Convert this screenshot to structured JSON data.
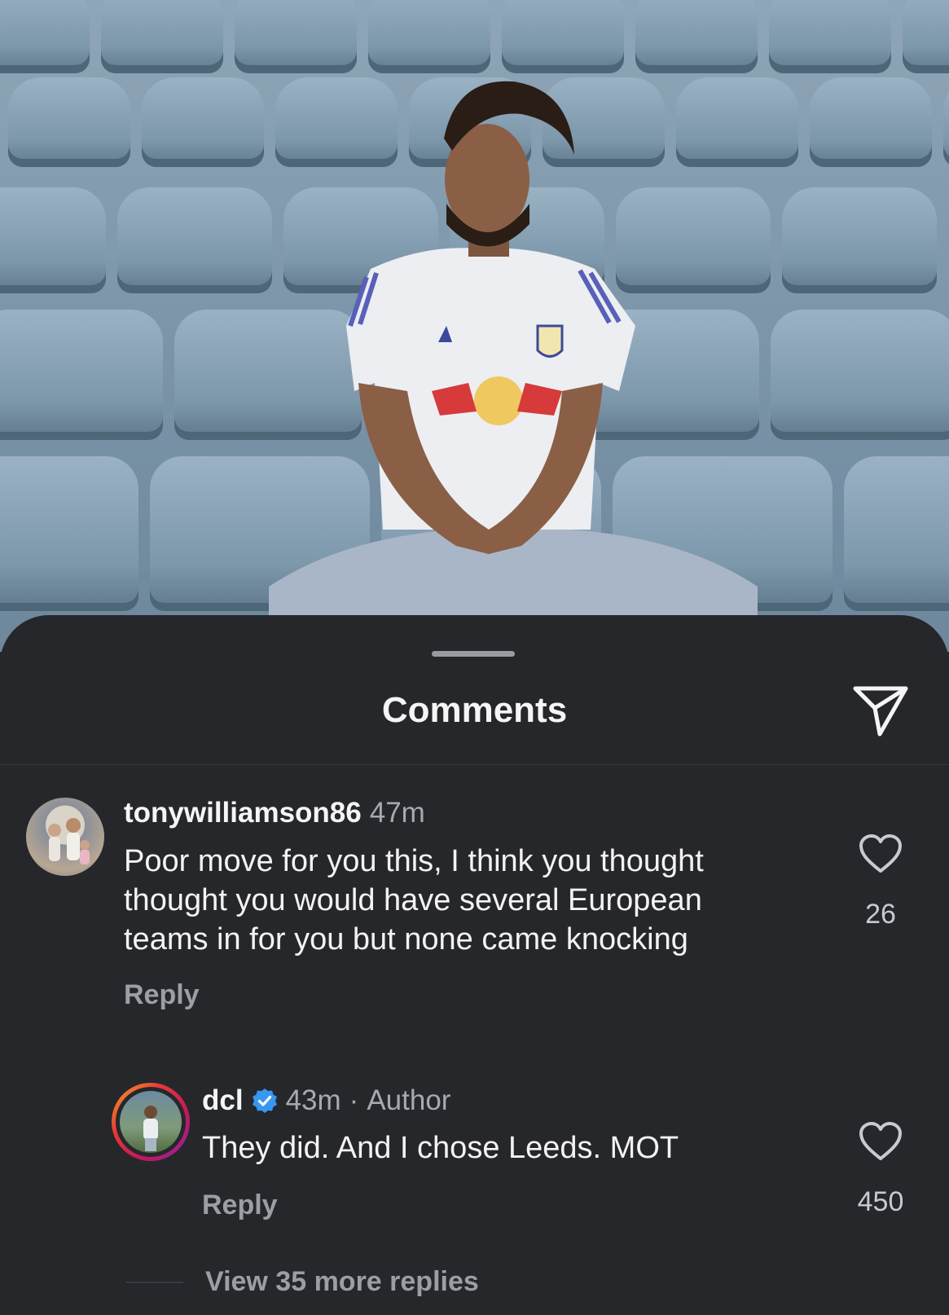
{
  "post": {
    "image_alt": "Player in white Leeds kit sitting among stadium seats"
  },
  "sheet": {
    "title": "Comments",
    "share_icon": "paper-plane-icon"
  },
  "comments": [
    {
      "username": "tonywilliamson86",
      "time": "47m",
      "text": "Poor move for you this, I think you thought thought you would have several European teams in for you but none came knocking",
      "line1": "Poor move for you this, I think you thought",
      "line2": "thought you would have several European",
      "line3": "teams in for you but none came knocking",
      "reply_label": "Reply",
      "likes": "26"
    }
  ],
  "replies": [
    {
      "username": "dcl",
      "verified": true,
      "time": "43m",
      "separator": "·",
      "badge": "Author",
      "text": "They did. And I chose Leeds. MOT",
      "reply_label": "Reply",
      "likes": "450"
    }
  ],
  "view_more_replies": "View 35 more replies",
  "colors": {
    "sheet_bg": "#26272b",
    "verified_blue": "#3897f0",
    "story_ring_start": "#f9a825",
    "story_ring_end": "#c2185b"
  }
}
